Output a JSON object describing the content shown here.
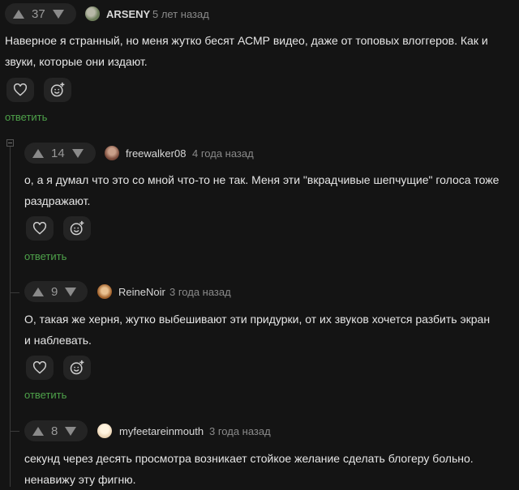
{
  "comments": [
    {
      "votes": "37",
      "author": "ARSENY",
      "time": "5 лет назад",
      "text": "Наверное я странный, но меня жутко бесят АСМР видео, даже от топовых влоггеров. Как и звуки, которые они издают.",
      "reply_label": "ответить",
      "avatar_colors": [
        "#6d7d5a",
        "#b8b8a8"
      ]
    },
    {
      "votes": "14",
      "author": "freewalker08",
      "time": "4 года назад",
      "text": "о, а я думал что это со мной что-то не так. Меня эти \"вкрадчивые шепчущие\" голоса тоже раздражают.",
      "reply_label": "ответить",
      "avatar_colors": [
        "#7a4a3a",
        "#c9a08a"
      ]
    },
    {
      "votes": "9",
      "author": "ReineNoir",
      "time": "3 года назад",
      "text": "О, такая же херня, жутко выбешивают эти придурки, от их звуков хочется разбить экран и наблевать.",
      "reply_label": "ответить",
      "avatar_colors": [
        "#a0602a",
        "#e8c090"
      ]
    },
    {
      "votes": "8",
      "author": "myfeetareinmouth",
      "time": "3 года назад",
      "text": "секунд через десять просмотра возникает стойкое желание сделать блогеру больно. ненавижу эту фигню.",
      "avatar_colors": [
        "#e8d0b0",
        "#fff4e0"
      ]
    }
  ],
  "icons": {
    "like": "heart-icon",
    "reaction": "smile-plus-icon",
    "collapse": "collapse-icon"
  },
  "colors": {
    "background": "#141414",
    "reply": "#4ea24a",
    "pill": "#242424"
  }
}
